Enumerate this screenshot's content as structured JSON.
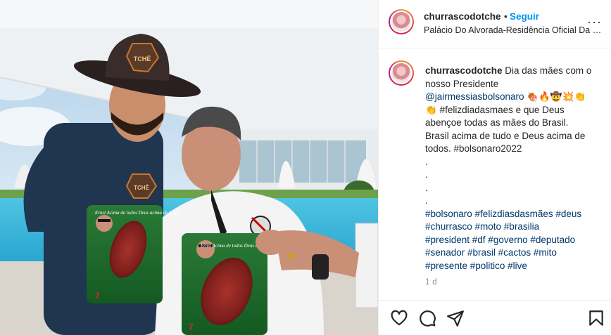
{
  "post": {
    "username": "churrascodotche",
    "follow_dot": "•",
    "follow_label": "Seguir",
    "location": "Palácio Do Alvorada-Residência Oficial Da Pre...",
    "more_label": "···",
    "caption": {
      "username": "churrascodotche",
      "lines": [
        "Dia das mães com o",
        "nosso Presidente",
        "@jairmessiasbolsonaro 🍖🔥🤠💥👏",
        "👏 #felizdiadasmaes e que Deus",
        "abençoe todas as mães do Brasil.",
        "Brasil acima de tudo e Deus acima de",
        "todos. #bolsonaro2022",
        ".",
        ".",
        ".",
        ".",
        "#bolsonaro #felizdiasdasmães #deus",
        "#churrasco #moto #brasilia",
        "#president #df #governo #deputado",
        "#senador #brasil #cactos #mito",
        "#presente #politico #live"
      ]
    },
    "time_ago": "1 d"
  },
  "photo": {
    "hat_badge": "TCHÊ",
    "shirt_badge": "TCHÊ",
    "package_text_1": "Ernst Acima de todos Deus acima de todos",
    "package_text_2": "Ernst Acima de todos Deus acima de todos",
    "package_brand_1": "7",
    "package_brand_2": "7"
  },
  "icons": {
    "like": "heart-icon",
    "comment": "comment-icon",
    "share": "share-icon",
    "save": "bookmark-icon"
  },
  "colors": {
    "follow_blue": "#0095f6",
    "hashtag": "#00376b",
    "muted": "#8e8e8e",
    "border": "#efefef"
  }
}
